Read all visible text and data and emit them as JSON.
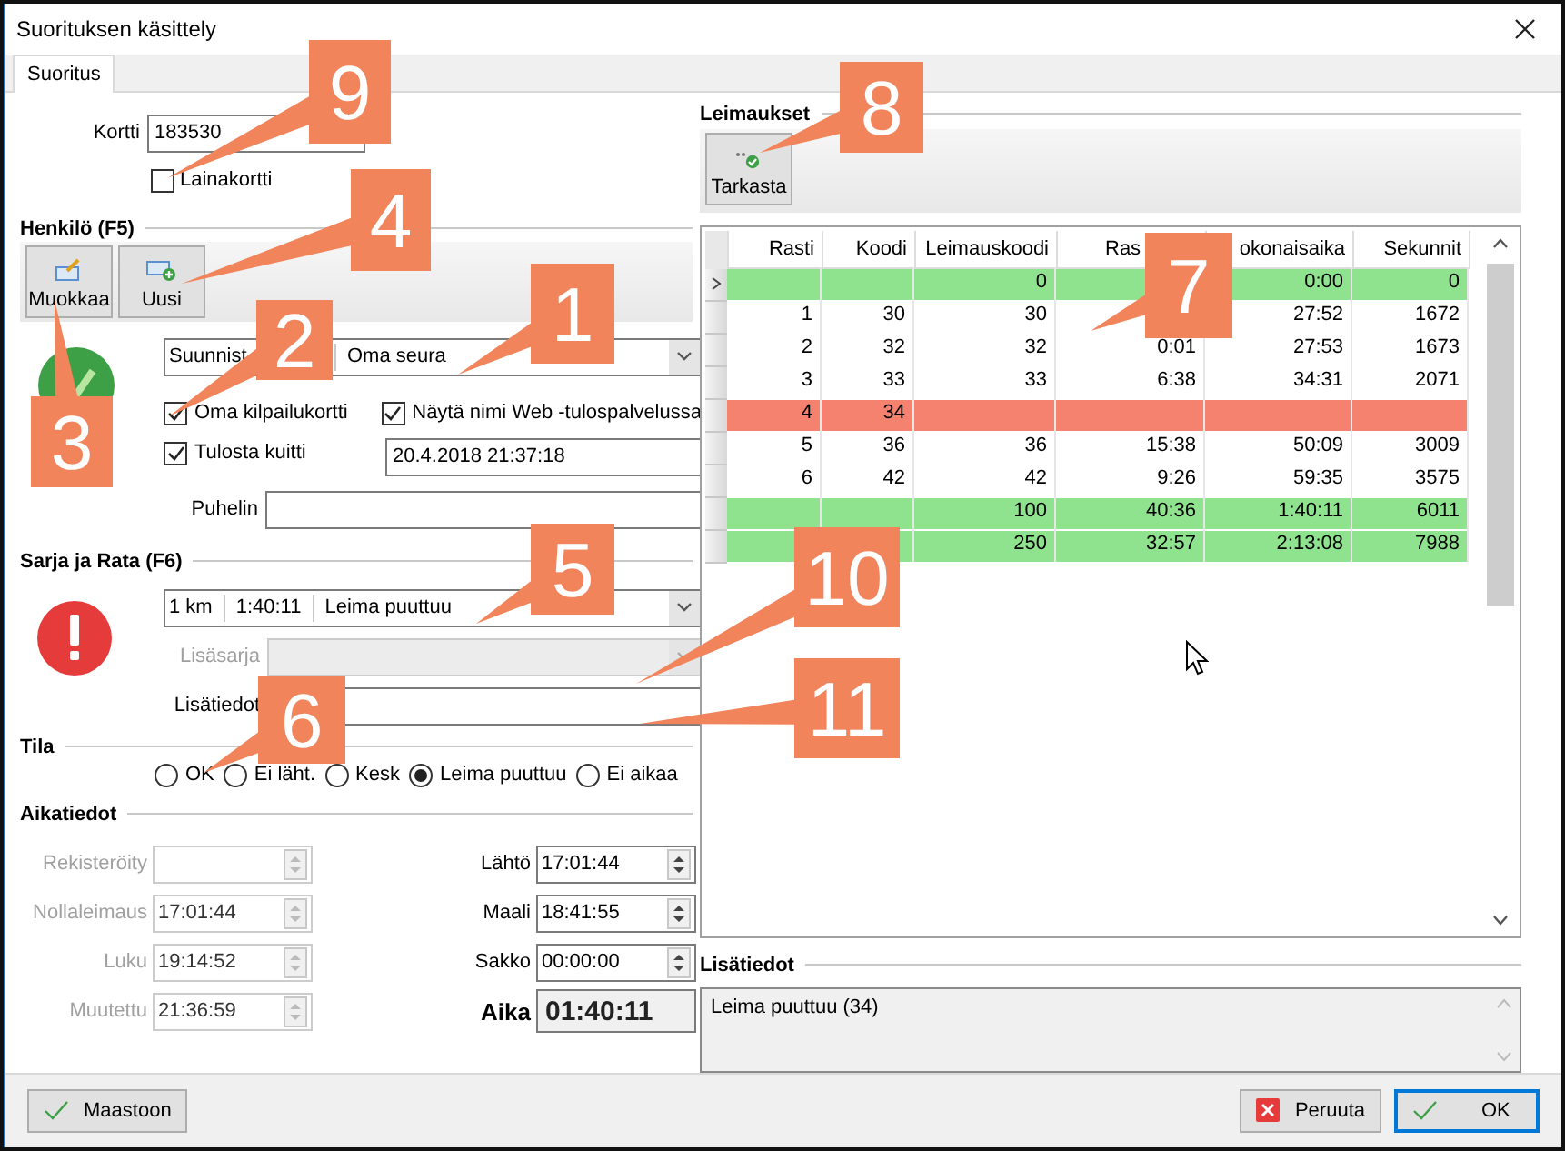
{
  "window": {
    "title": "Suorituksen käsittely"
  },
  "tabs": [
    {
      "label": "Suoritus",
      "selected": true
    }
  ],
  "card": {
    "label": "Kortti",
    "value": "183530",
    "loan_card": {
      "label": "Lainakortti",
      "checked": false
    }
  },
  "person": {
    "heading": "Henkilö (F5)",
    "buttons": [
      "Muokkaa",
      "Uusi"
    ],
    "club_combo": [
      "Suunnist",
      "Oma seura"
    ],
    "checkboxes": [
      {
        "label": "Oma kilpailukortti",
        "checked": true
      },
      {
        "label": "Näytä nimi Web -tulospalvelussa",
        "checked": true
      },
      {
        "label": "Tulosta kuitti",
        "checked": true
      }
    ],
    "printed_at": "20.4.2018 21:37:18",
    "phone": {
      "label": "Puhelin"
    }
  },
  "class_course": {
    "heading": "Sarja ja Rata (F6)",
    "combo": [
      "1 km",
      "1:40:11",
      "Leima puuttuu"
    ],
    "extra_class": {
      "label": "Lisäsarja",
      "disabled": true
    },
    "notes": {
      "label": "Lisätiedot"
    }
  },
  "status": {
    "heading": "Tila",
    "options": [
      {
        "label": "OK",
        "selected": false
      },
      {
        "label": "Ei läht.",
        "selected": false
      },
      {
        "label": "Kesk",
        "selected": false
      },
      {
        "label": "Leima puuttuu",
        "selected": true
      },
      {
        "label": "Ei aikaa",
        "selected": false
      }
    ]
  },
  "times": {
    "heading": "Aikatiedot",
    "left": [
      {
        "label": "Rekisteröity",
        "disabled": true
      },
      {
        "label": "Nollaleimaus",
        "value": "17:01:44",
        "disabled": true
      },
      {
        "label": "Luku",
        "value": "19:14:52",
        "disabled": true
      },
      {
        "label": "Muutettu",
        "value": "21:36:59",
        "disabled": true
      }
    ],
    "right": [
      {
        "label": "Lähtö",
        "value": "17:01:44",
        "disabled": false
      },
      {
        "label": "Maali",
        "value": "18:41:55",
        "disabled": false
      },
      {
        "label": "Sakko",
        "value": "00:00:00",
        "disabled": false
      }
    ],
    "result": {
      "label": "Aika",
      "value": "01:40:11"
    }
  },
  "punches": {
    "heading": "Leimaukset",
    "buttons": [
      "Tarkasta"
    ],
    "columns": [
      "Rasti",
      "Koodi",
      "Leimauskoodi",
      "Ras",
      "okonaisaika",
      "Sekunnit"
    ],
    "rows": [
      {
        "kind": "ok",
        "selected": true,
        "cells": [
          null,
          null,
          "0",
          null,
          "0:00",
          "0"
        ]
      },
      {
        "kind": "normal",
        "selected": false,
        "cells": [
          "1",
          "30",
          "30",
          null,
          "27:52",
          "1672"
        ]
      },
      {
        "kind": "normal",
        "selected": false,
        "cells": [
          "2",
          "32",
          "32",
          "0:01",
          "27:53",
          "1673"
        ]
      },
      {
        "kind": "normal",
        "selected": false,
        "cells": [
          "3",
          "33",
          "33",
          "6:38",
          "34:31",
          "2071"
        ]
      },
      {
        "kind": "missing",
        "selected": false,
        "cells": [
          "4",
          "34",
          null,
          null,
          null,
          null
        ]
      },
      {
        "kind": "normal",
        "selected": false,
        "cells": [
          "5",
          "36",
          "36",
          "15:38",
          "50:09",
          "3009"
        ]
      },
      {
        "kind": "normal",
        "selected": false,
        "cells": [
          "6",
          "42",
          "42",
          "9:26",
          "59:35",
          "3575"
        ]
      },
      {
        "kind": "ok",
        "selected": false,
        "cells": [
          null,
          null,
          "100",
          "40:36",
          "1:40:11",
          "6011"
        ]
      },
      {
        "kind": "ok",
        "selected": false,
        "cells": [
          null,
          null,
          "250",
          "32:57",
          "2:13:08",
          "7988"
        ]
      }
    ]
  },
  "details": {
    "heading": "Lisätiedot",
    "text": "Leima puuttuu (34)"
  },
  "footer": {
    "buttons": [
      {
        "label": "Maastoon",
        "kind": "accept",
        "default": false
      },
      {
        "label": "Peruuta",
        "kind": "cancel",
        "default": false
      },
      {
        "label": "OK",
        "kind": "accept",
        "default": true
      }
    ]
  },
  "callouts": [
    {
      "number": "9"
    },
    {
      "number": "8"
    },
    {
      "number": "4"
    },
    {
      "number": "1"
    },
    {
      "number": "7"
    },
    {
      "number": "2"
    },
    {
      "number": "3"
    },
    {
      "number": "5"
    },
    {
      "number": "10"
    },
    {
      "number": "11"
    },
    {
      "number": "6"
    }
  ]
}
